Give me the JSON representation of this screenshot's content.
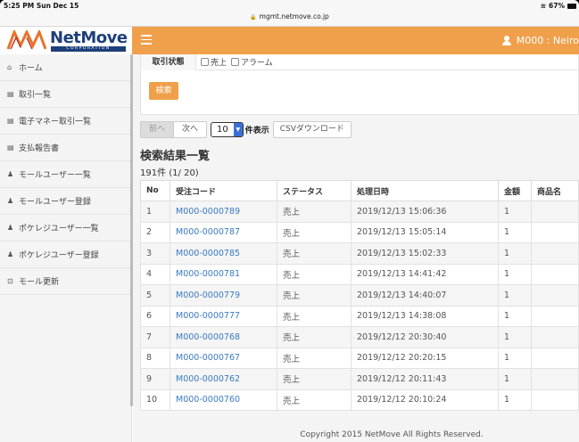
{
  "statusbar": {
    "time": "5:25 PM  Sun Dec 15",
    "battery": "67%",
    "url": "mgmt.netmove.co.jp"
  },
  "header": {
    "logo_text": "NetMove",
    "logo_sub": "CORPORATION",
    "user": "M000 : Neiro"
  },
  "sidebar": {
    "items": [
      {
        "icon": "home-icon",
        "glyph": "⌂",
        "label": "ホーム"
      },
      {
        "icon": "document-icon",
        "glyph": "▤",
        "label": "取引一覧"
      },
      {
        "icon": "document-icon",
        "glyph": "▤",
        "label": "電子マネー取引一覧"
      },
      {
        "icon": "document-icon",
        "glyph": "▤",
        "label": "支払報告書"
      },
      {
        "icon": "user-icon",
        "glyph": "♟",
        "label": "モールユーザー一覧"
      },
      {
        "icon": "user-icon",
        "glyph": "♟",
        "label": "モールユーザー登録"
      },
      {
        "icon": "users-icon",
        "glyph": "♟",
        "label": "ポケレジユーザー一覧"
      },
      {
        "icon": "users-icon",
        "glyph": "♟",
        "label": "ポケレジユーザー登録"
      },
      {
        "icon": "cart-icon",
        "glyph": "⊡",
        "label": "モール更新"
      }
    ]
  },
  "filter": {
    "label": "取引状態",
    "options": [
      "売上",
      "アラーム"
    ],
    "search_button": "検索"
  },
  "pager": {
    "prev": "前へ",
    "next": "次へ",
    "per_page": "10",
    "per_page_label": "件表示",
    "csv": "CSVダウンロード"
  },
  "results": {
    "title": "検索結果一覧",
    "count": "191件 (1/ 20)",
    "columns": [
      "No",
      "受注コード",
      "ステータス",
      "処理日時",
      "金額",
      "商品名"
    ],
    "rows": [
      {
        "no": "1",
        "code": "M000-0000789",
        "status": "売上",
        "date": "2019/12/13 15:06:36",
        "amount": "1",
        "product": ""
      },
      {
        "no": "2",
        "code": "M000-0000787",
        "status": "売上",
        "date": "2019/12/13 15:05:14",
        "amount": "1",
        "product": ""
      },
      {
        "no": "3",
        "code": "M000-0000785",
        "status": "売上",
        "date": "2019/12/13 15:02:33",
        "amount": "1",
        "product": ""
      },
      {
        "no": "4",
        "code": "M000-0000781",
        "status": "売上",
        "date": "2019/12/13 14:41:42",
        "amount": "1",
        "product": ""
      },
      {
        "no": "5",
        "code": "M000-0000779",
        "status": "売上",
        "date": "2019/12/13 14:40:07",
        "amount": "1",
        "product": ""
      },
      {
        "no": "6",
        "code": "M000-0000777",
        "status": "売上",
        "date": "2019/12/13 14:38:08",
        "amount": "1",
        "product": ""
      },
      {
        "no": "7",
        "code": "M000-0000768",
        "status": "売上",
        "date": "2019/12/12 20:30:40",
        "amount": "1",
        "product": ""
      },
      {
        "no": "8",
        "code": "M000-0000767",
        "status": "売上",
        "date": "2019/12/12 20:20:15",
        "amount": "1",
        "product": ""
      },
      {
        "no": "9",
        "code": "M000-0000762",
        "status": "売上",
        "date": "2019/12/12 20:11:43",
        "amount": "1",
        "product": ""
      },
      {
        "no": "10",
        "code": "M000-0000760",
        "status": "売上",
        "date": "2019/12/12 20:10:24",
        "amount": "1",
        "product": ""
      }
    ]
  },
  "footer": {
    "text": "Copyright 2015 NetMove All Rights Reserved."
  },
  "colors": {
    "accent": "#f0a04b",
    "brand": "#1e3f7a",
    "link": "#3a7bbf"
  }
}
